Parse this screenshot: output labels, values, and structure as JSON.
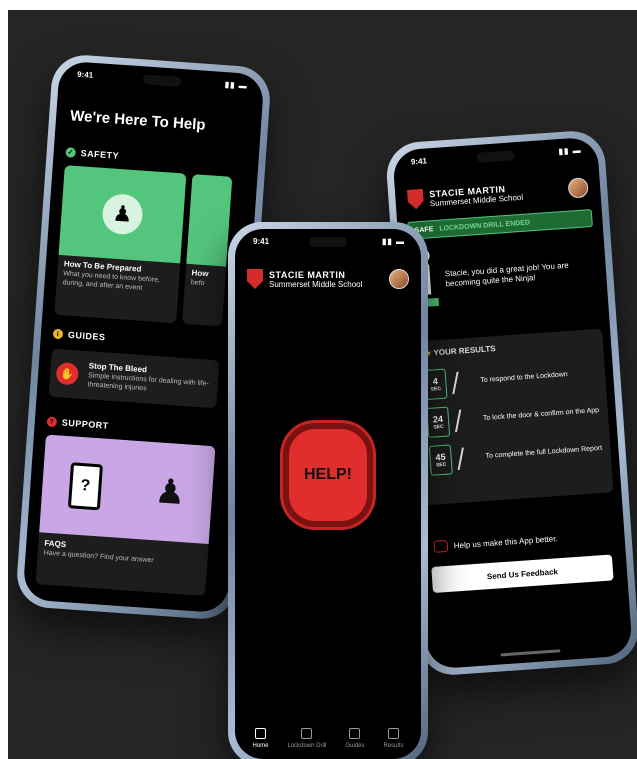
{
  "phone1": {
    "time": "9:41",
    "title": "We're Here To Help",
    "sections": {
      "safety": "SAFETY",
      "guides": "GUIDES",
      "support": "SUPPORT"
    },
    "card_prepared": {
      "title": "How To Be Prepared",
      "text": "What you need to know before, during, and after an event"
    },
    "card_partial": {
      "title": "How",
      "text": "befo"
    },
    "card_bleed": {
      "title": "Stop The Bleed",
      "text": "Simple instructions for dealing with life-threatening injuries"
    },
    "card_faq": {
      "title": "FAQS",
      "text": "Have a question? Find your answer"
    }
  },
  "phone2": {
    "time": "9:41",
    "name": "STACIE MARTIN",
    "school": "Summerset Middle School",
    "help_label": "HELP!",
    "tabs": [
      "Home",
      "Lockdown Drill",
      "Guides",
      "Results"
    ]
  },
  "phone3": {
    "time": "9:41",
    "name": "STACIE MARTIN",
    "school": "Summerset Middle School",
    "status_safe": "SAFE",
    "status_rest": "LOCKDOWN DRILL ENDED",
    "message": "Stacie, you did a great job! You are becoming quite the Ninja!",
    "results_title": "YOUR RESULTS",
    "results": [
      {
        "value": "4",
        "unit": "SEC",
        "text": "To respond to the Lockdown"
      },
      {
        "value": "24",
        "unit": "SEC",
        "text": "To lock the door & confirm on the App"
      },
      {
        "value": "45",
        "unit": "SEC",
        "text": "To complete the full Lockdown Report"
      }
    ],
    "improve": "Help us make this App better.",
    "feedback_button": "Send Us Feedback"
  },
  "colors": {
    "accent_green": "#54c57c",
    "alert_red": "#e22d2d",
    "background": "#252525"
  }
}
